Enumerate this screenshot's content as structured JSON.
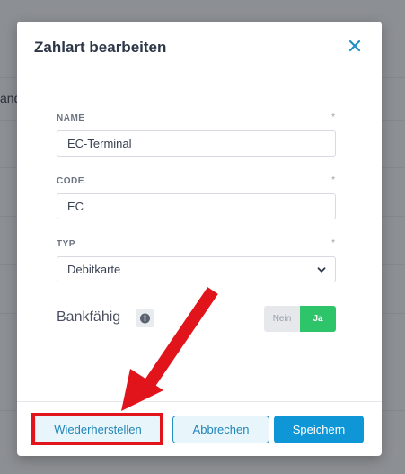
{
  "background": {
    "partial_text": "and"
  },
  "modal": {
    "title": "Zahlart bearbeiten",
    "close_icon": "close-icon",
    "fields": {
      "name": {
        "label": "NAME",
        "required_mark": "*",
        "value": "EC-Terminal"
      },
      "code": {
        "label": "CODE",
        "required_mark": "*",
        "value": "EC"
      },
      "type": {
        "label": "TYP",
        "required_mark": "*",
        "value": "Debitkarte"
      }
    },
    "bankfaehig": {
      "label": "Bankfähig",
      "info_icon": "info-icon",
      "toggle_no": "Nein",
      "toggle_yes": "Ja",
      "selected": "Ja"
    },
    "footer": {
      "restore_label": "Wiederherstellen",
      "cancel_label": "Abbrechen",
      "save_label": "Speichern"
    }
  },
  "annotation": {
    "color": "#e0141a"
  }
}
